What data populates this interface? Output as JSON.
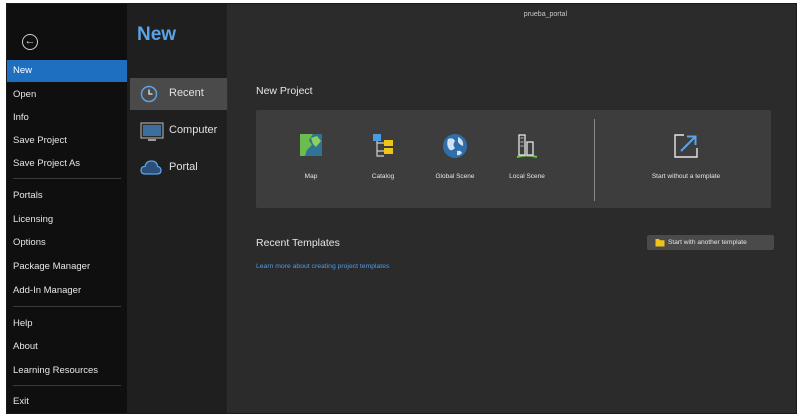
{
  "window": {
    "title": "prueba_portal"
  },
  "sidebar": {
    "items": [
      {
        "label": "New"
      },
      {
        "label": "Open"
      },
      {
        "label": "Info"
      },
      {
        "label": "Save Project"
      },
      {
        "label": "Save Project As"
      },
      {
        "label": "Portals"
      },
      {
        "label": "Licensing"
      },
      {
        "label": "Options"
      },
      {
        "label": "Package Manager"
      },
      {
        "label": "Add-In Manager"
      },
      {
        "label": "Help"
      },
      {
        "label": "About"
      },
      {
        "label": "Learning Resources"
      },
      {
        "label": "Exit"
      }
    ]
  },
  "page": {
    "heading": "New"
  },
  "subnav": {
    "items": [
      {
        "label": "Recent",
        "icon": "clock-icon"
      },
      {
        "label": "Computer",
        "icon": "monitor-icon"
      },
      {
        "label": "Portal",
        "icon": "cloud-icon"
      }
    ]
  },
  "new_project": {
    "title": "New Project",
    "templates": [
      {
        "label": "Map",
        "icon": "map-icon"
      },
      {
        "label": "Catalog",
        "icon": "catalog-icon"
      },
      {
        "label": "Global Scene",
        "icon": "globe-icon"
      },
      {
        "label": "Local Scene",
        "icon": "local-scene-icon"
      },
      {
        "label": "Start without a template",
        "icon": "arrow-out-icon"
      }
    ]
  },
  "recent_templates": {
    "title": "Recent Templates",
    "learn_link": "Learn more about creating project templates",
    "start_another": "Start with another template"
  },
  "colors": {
    "accent": "#1f6fc0",
    "heading": "#5aa3e6",
    "link": "#4d9be6"
  }
}
